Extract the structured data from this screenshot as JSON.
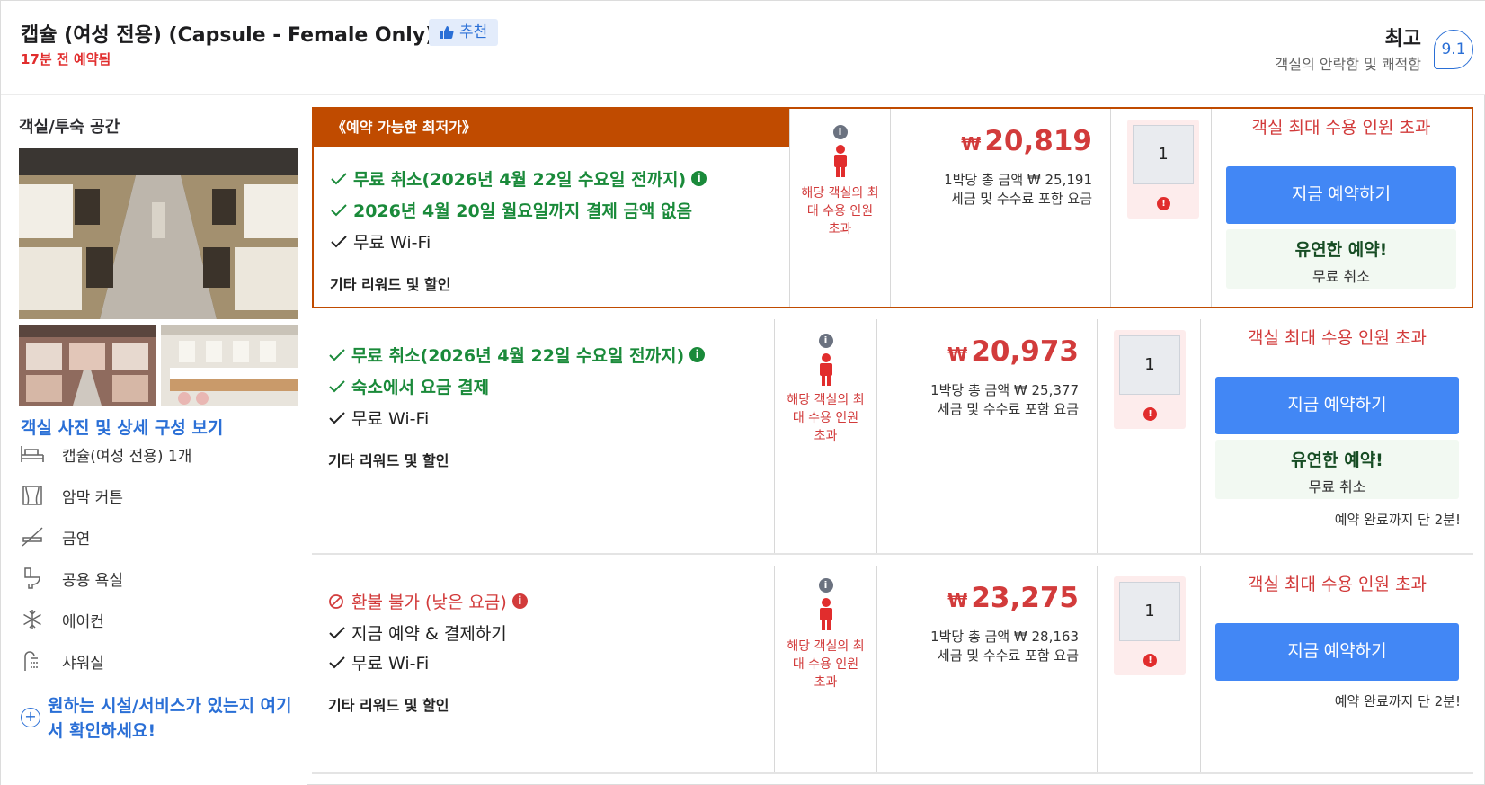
{
  "header": {
    "room_title": "캡슐 (여성 전용) (Capsule - Female Only)",
    "recommend_label": "추천",
    "booked_ago": "17분 전 예약됨",
    "rating_word": "최고",
    "rating_sub": "객실의 안락함 및 쾌적함",
    "score": "9.1"
  },
  "left": {
    "section_title": "객실/투숙 공간",
    "photo_link": "객실 사진 및 상세 구성 보기",
    "amenities": [
      {
        "icon": "bed-icon",
        "label": "캡슐(여성 전용) 1개"
      },
      {
        "icon": "curtain-icon",
        "label": "암막 커튼"
      },
      {
        "icon": "no-smoking-icon",
        "label": "금연"
      },
      {
        "icon": "toilet-icon",
        "label": "공용 욕실"
      },
      {
        "icon": "snowflake-icon",
        "label": "에어컨"
      },
      {
        "icon": "shower-icon",
        "label": "샤워실"
      }
    ],
    "amenity_cta": "원하는 시설/서비스가 있는지 여기서 확인하세요!"
  },
  "rows": [
    {
      "best_tag": "《예약 가능한 최저가》",
      "features": [
        {
          "type": "green",
          "text": "무료 취소(2026년 4월 22일 수요일 전까지)",
          "info": true
        },
        {
          "type": "green",
          "text": "2026년 4월 20일 월요일까지 결제 금액 없음",
          "info": false
        },
        {
          "type": "plain",
          "text": "무료 Wi-Fi",
          "info": false
        }
      ],
      "others": "기타 리워드 및 할인",
      "occupancy_text": "해당 객실의 최대 수용 인원 초과",
      "currency": "₩",
      "price": "20,819",
      "total": "1박당 총 금액 ₩ 25,191",
      "tax_note": "세금 및 수수료 포함 요금",
      "qty": "1",
      "exceed": "객실 최대 수용 인원 초과",
      "book_label": "지금 예약하기",
      "flex_title": "유연한 예약!",
      "flex_sub": "무료 취소",
      "hurry": ""
    },
    {
      "best_tag": "",
      "features": [
        {
          "type": "green",
          "text": "무료 취소(2026년 4월 22일 수요일 전까지)",
          "info": true
        },
        {
          "type": "green",
          "text": "숙소에서 요금 결제",
          "info": false
        },
        {
          "type": "plain",
          "text": "무료 Wi-Fi",
          "info": false
        }
      ],
      "others": "기타 리워드 및 할인",
      "occupancy_text": "해당 객실의 최대 수용 인원 초과",
      "currency": "₩",
      "price": "20,973",
      "total": "1박당 총 금액 ₩ 25,377",
      "tax_note": "세금 및 수수료 포함 요금",
      "qty": "1",
      "exceed": "객실 최대 수용 인원 초과",
      "book_label": "지금 예약하기",
      "flex_title": "유연한 예약!",
      "flex_sub": "무료 취소",
      "hurry": "예약 완료까지 단 2분!"
    },
    {
      "best_tag": "",
      "features": [
        {
          "type": "red",
          "text": "환불 불가 (낮은 요금)",
          "info": true
        },
        {
          "type": "plain",
          "text": "지금 예약 & 결제하기",
          "info": false
        },
        {
          "type": "plain",
          "text": "무료 Wi-Fi",
          "info": false
        }
      ],
      "others": "기타 리워드 및 할인",
      "occupancy_text": "해당 객실의 최대 수용 인원 초과",
      "currency": "₩",
      "price": "23,275",
      "total": "1박당 총 금액 ₩ 28,163",
      "tax_note": "세금 및 수수료 포함 요금",
      "qty": "1",
      "exceed": "객실 최대 수용 인원 초과",
      "book_label": "지금 예약하기",
      "flex_title": "",
      "flex_sub": "",
      "hurry": "예약 완료까지 단 2분!"
    }
  ],
  "colors": {
    "accent_blue": "#4287f5",
    "best_orange": "#c04b00",
    "price_red": "#d23b3b",
    "green": "#1a8a3a"
  }
}
